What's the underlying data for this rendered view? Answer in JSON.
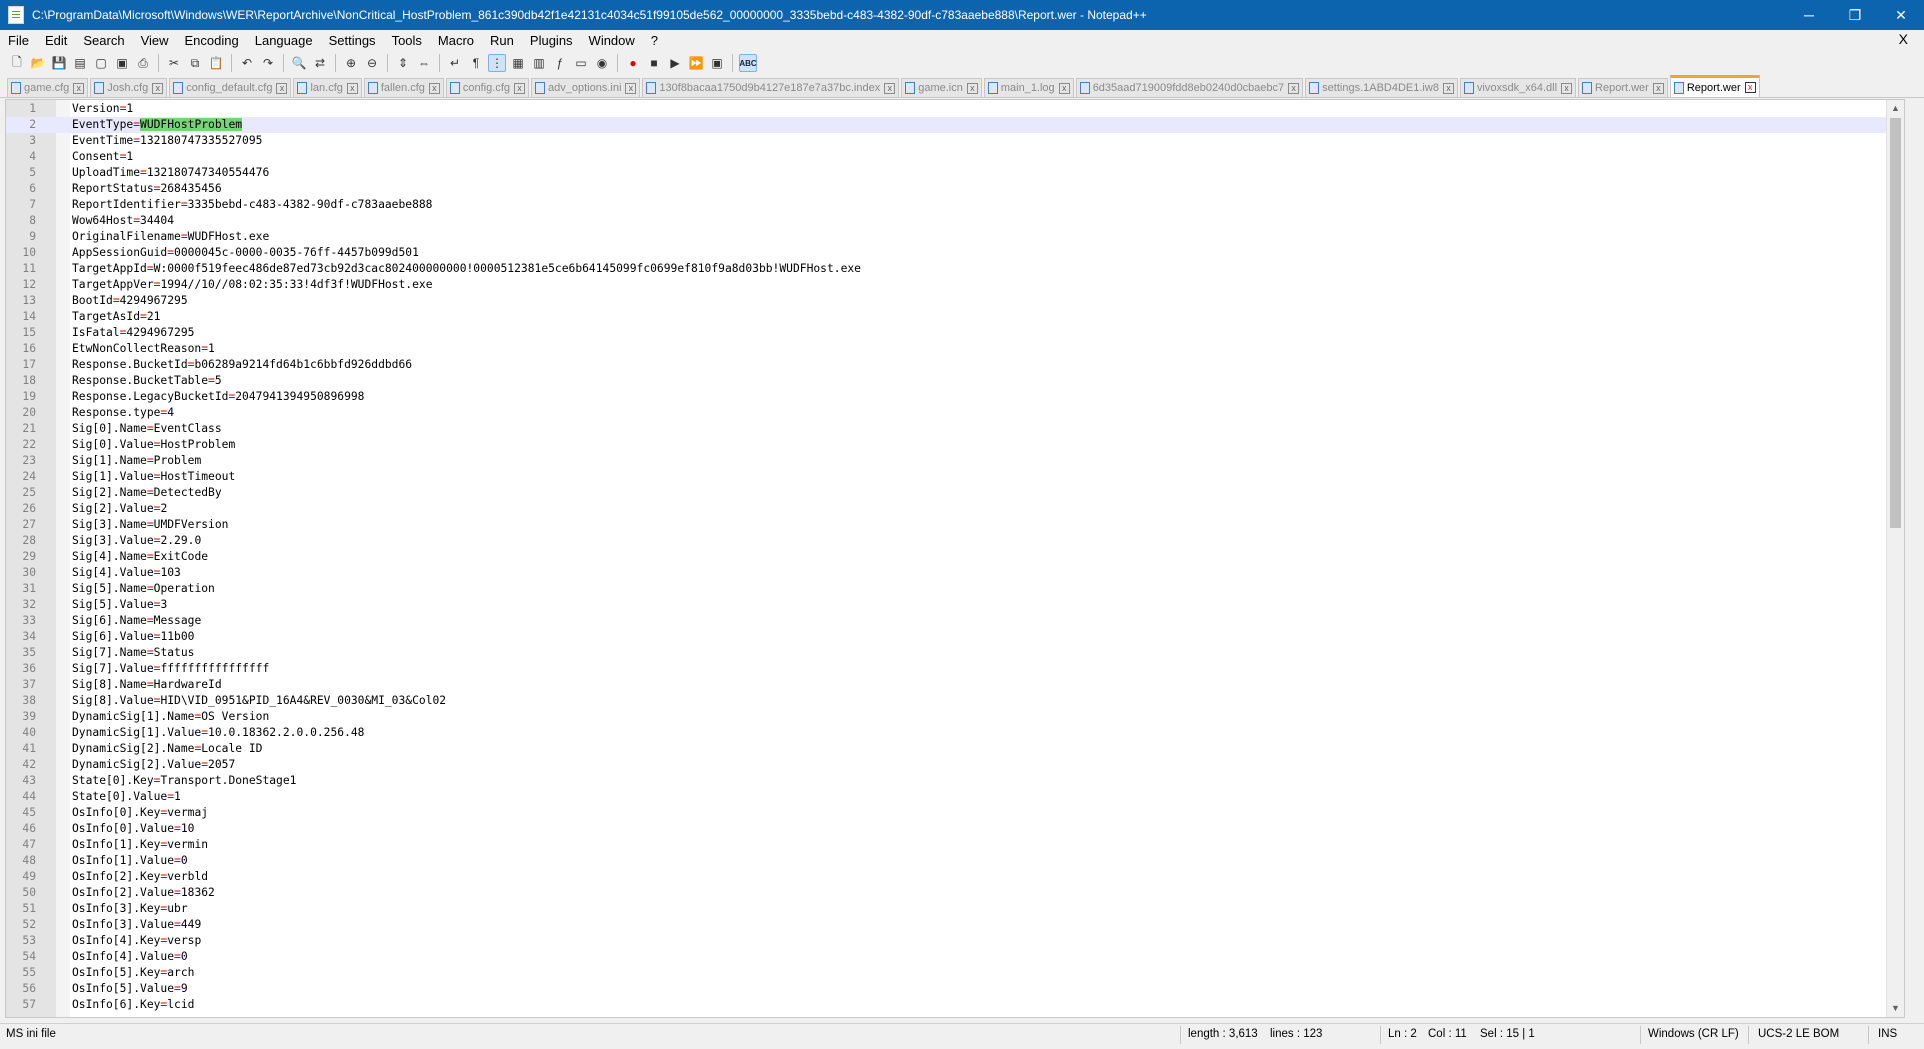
{
  "window": {
    "title": "C:\\ProgramData\\Microsoft\\Windows\\WER\\ReportArchive\\NonCritical_HostProblem_861c390db42f1e42131c4034c51f99105de562_00000000_3335bebd-c483-4382-90df-c783aaebe888\\Report.wer - Notepad++",
    "controls": {
      "minimize": "─",
      "maximize": "❐",
      "close": "✕"
    }
  },
  "menu": [
    "File",
    "Edit",
    "Search",
    "View",
    "Encoding",
    "Language",
    "Settings",
    "Tools",
    "Macro",
    "Run",
    "Plugins",
    "Window",
    "?"
  ],
  "menu_close": "X",
  "toolbar": {
    "icons": [
      "new-file",
      "open-file",
      "save",
      "save-all",
      "close",
      "close-all",
      "print",
      "cut",
      "copy",
      "paste",
      "undo",
      "redo",
      "find",
      "replace",
      "zoom-in",
      "zoom-out",
      "sync-vertical",
      "sync-horizontal",
      "word-wrap",
      "show-all-chars",
      "indent-guide",
      "udl",
      "doc-map",
      "function-list",
      "folder-workspace",
      "monitoring",
      "record-macro",
      "stop-record",
      "play-macro",
      "run-macro-multiple",
      "save-macro",
      "spell-check"
    ],
    "abc_label": "ABC"
  },
  "tabs": [
    {
      "label": "game.cfg",
      "active": false
    },
    {
      "label": "Josh.cfg",
      "active": false
    },
    {
      "label": "config_default.cfg",
      "active": false
    },
    {
      "label": "lan.cfg",
      "active": false
    },
    {
      "label": "fallen.cfg",
      "active": false
    },
    {
      "label": "config.cfg",
      "active": false
    },
    {
      "label": "adv_options.ini",
      "active": false
    },
    {
      "label": "130f8bacaa1750d9b4127e187e7a37bc.index",
      "active": false
    },
    {
      "label": "game.icn",
      "active": false
    },
    {
      "label": "main_1.log",
      "active": false
    },
    {
      "label": "6d35aad719009fdd8eb0240d0cbaebc7",
      "active": false
    },
    {
      "label": "settings.1ABD4DE1.iw8",
      "active": false
    },
    {
      "label": "vivoxsdk_x64.dll",
      "active": false
    },
    {
      "label": "Report.wer",
      "active": false
    },
    {
      "label": "Report.wer",
      "active": true
    }
  ],
  "tab_close_glyph": "x",
  "editor": {
    "current_line": 2,
    "selected_text": "WUDFHostProblem",
    "lines": [
      {
        "n": "1",
        "key": "Version",
        "value": "1"
      },
      {
        "n": "2",
        "key": "EventType",
        "value": "WUDFHostProblem"
      },
      {
        "n": "3",
        "key": "EventTime",
        "value": "132180747335527095"
      },
      {
        "n": "4",
        "key": "Consent",
        "value": "1"
      },
      {
        "n": "5",
        "key": "UploadTime",
        "value": "132180747340554476"
      },
      {
        "n": "6",
        "key": "ReportStatus",
        "value": "268435456"
      },
      {
        "n": "7",
        "key": "ReportIdentifier",
        "value": "3335bebd-c483-4382-90df-c783aaebe888"
      },
      {
        "n": "8",
        "key": "Wow64Host",
        "value": "34404"
      },
      {
        "n": "9",
        "key": "OriginalFilename",
        "value": "WUDFHost.exe"
      },
      {
        "n": "10",
        "key": "AppSessionGuid",
        "value": "0000045c-0000-0035-76ff-4457b099d501"
      },
      {
        "n": "11",
        "key": "TargetAppId",
        "value": "W:0000f519feec486de87ed73cb92d3cac802400000000!0000512381e5ce6b64145099fc0699ef810f9a8d03bb!WUDFHost.exe"
      },
      {
        "n": "12",
        "key": "TargetAppVer",
        "value": "1994//10//08:02:35:33!4df3f!WUDFHost.exe"
      },
      {
        "n": "13",
        "key": "BootId",
        "value": "4294967295"
      },
      {
        "n": "14",
        "key": "TargetAsId",
        "value": "21"
      },
      {
        "n": "15",
        "key": "IsFatal",
        "value": "4294967295"
      },
      {
        "n": "16",
        "key": "EtwNonCollectReason",
        "value": "1"
      },
      {
        "n": "17",
        "key": "Response.BucketId",
        "value": "b06289a9214fd64b1c6bbfd926ddbd66"
      },
      {
        "n": "18",
        "key": "Response.BucketTable",
        "value": "5"
      },
      {
        "n": "19",
        "key": "Response.LegacyBucketId",
        "value": "2047941394950896998"
      },
      {
        "n": "20",
        "key": "Response.type",
        "value": "4"
      },
      {
        "n": "21",
        "key": "Sig[0].Name",
        "value": "EventClass"
      },
      {
        "n": "22",
        "key": "Sig[0].Value",
        "value": "HostProblem"
      },
      {
        "n": "23",
        "key": "Sig[1].Name",
        "value": "Problem"
      },
      {
        "n": "24",
        "key": "Sig[1].Value",
        "value": "HostTimeout"
      },
      {
        "n": "25",
        "key": "Sig[2].Name",
        "value": "DetectedBy"
      },
      {
        "n": "26",
        "key": "Sig[2].Value",
        "value": "2"
      },
      {
        "n": "27",
        "key": "Sig[3].Name",
        "value": "UMDFVersion"
      },
      {
        "n": "28",
        "key": "Sig[3].Value",
        "value": "2.29.0"
      },
      {
        "n": "29",
        "key": "Sig[4].Name",
        "value": "ExitCode"
      },
      {
        "n": "30",
        "key": "Sig[4].Value",
        "value": "103"
      },
      {
        "n": "31",
        "key": "Sig[5].Name",
        "value": "Operation"
      },
      {
        "n": "32",
        "key": "Sig[5].Value",
        "value": "3"
      },
      {
        "n": "33",
        "key": "Sig[6].Name",
        "value": "Message"
      },
      {
        "n": "34",
        "key": "Sig[6].Value",
        "value": "11b00"
      },
      {
        "n": "35",
        "key": "Sig[7].Name",
        "value": "Status"
      },
      {
        "n": "36",
        "key": "Sig[7].Value",
        "value": "ffffffffffffffff"
      },
      {
        "n": "37",
        "key": "Sig[8].Name",
        "value": "HardwareId"
      },
      {
        "n": "38",
        "key": "Sig[8].Value",
        "value": "HID\\VID_0951&PID_16A4&REV_0030&MI_03&Col02"
      },
      {
        "n": "39",
        "key": "DynamicSig[1].Name",
        "value": "OS Version"
      },
      {
        "n": "40",
        "key": "DynamicSig[1].Value",
        "value": "10.0.18362.2.0.0.256.48"
      },
      {
        "n": "41",
        "key": "DynamicSig[2].Name",
        "value": "Locale ID"
      },
      {
        "n": "42",
        "key": "DynamicSig[2].Value",
        "value": "2057"
      },
      {
        "n": "43",
        "key": "State[0].Key",
        "value": "Transport.DoneStage1"
      },
      {
        "n": "44",
        "key": "State[0].Value",
        "value": "1"
      },
      {
        "n": "45",
        "key": "OsInfo[0].Key",
        "value": "vermaj"
      },
      {
        "n": "46",
        "key": "OsInfo[0].Value",
        "value": "10"
      },
      {
        "n": "47",
        "key": "OsInfo[1].Key",
        "value": "vermin"
      },
      {
        "n": "48",
        "key": "OsInfo[1].Value",
        "value": "0"
      },
      {
        "n": "49",
        "key": "OsInfo[2].Key",
        "value": "verbld"
      },
      {
        "n": "50",
        "key": "OsInfo[2].Value",
        "value": "18362"
      },
      {
        "n": "51",
        "key": "OsInfo[3].Key",
        "value": "ubr"
      },
      {
        "n": "52",
        "key": "OsInfo[3].Value",
        "value": "449"
      },
      {
        "n": "53",
        "key": "OsInfo[4].Key",
        "value": "versp"
      },
      {
        "n": "54",
        "key": "OsInfo[4].Value",
        "value": "0"
      },
      {
        "n": "55",
        "key": "OsInfo[5].Key",
        "value": "arch"
      },
      {
        "n": "56",
        "key": "OsInfo[5].Value",
        "value": "9"
      },
      {
        "n": "57",
        "key": "OsInfo[6].Key",
        "value": "lcid"
      }
    ]
  },
  "status": {
    "file_type": "MS ini file",
    "length": "length : 3,613",
    "lines": "lines : 123",
    "ln": "Ln : 2",
    "col": "Col : 11",
    "sel": "Sel : 15 | 1",
    "eol": "Windows (CR LF)",
    "encoding": "UCS-2 LE BOM",
    "mode": "INS"
  },
  "colors": {
    "titlebar": "#0c64ae",
    "key_text": "#000000",
    "equals_sign": "#d40000",
    "selection": "#78d378",
    "current_line": "#e8e8ff",
    "active_tab_accent": "#f6a23a"
  }
}
